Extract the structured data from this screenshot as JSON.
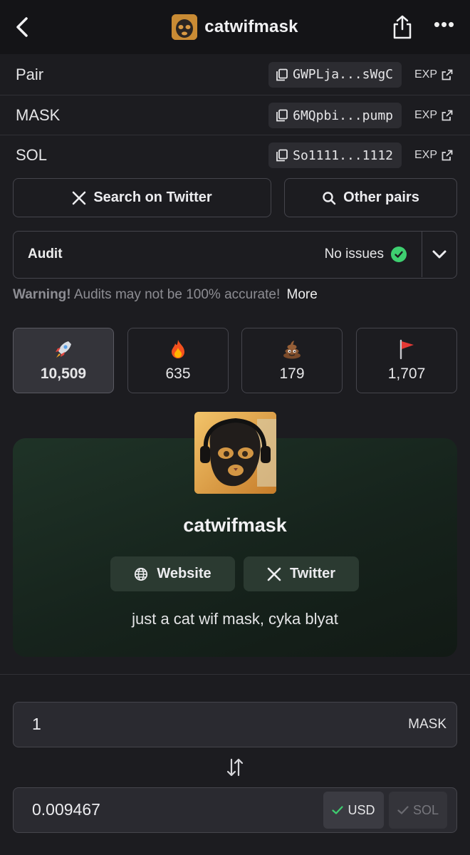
{
  "header": {
    "title": "catwifmask",
    "back_icon": "chevron-left-icon",
    "share_icon": "share-icon",
    "more_icon": "ellipsis-icon",
    "more_glyph": "•••"
  },
  "addresses": [
    {
      "label": "Pair",
      "address": "GWPLja...sWgC",
      "explorer": "EXP"
    },
    {
      "label": "MASK",
      "address": "6MQpbi...pump",
      "explorer": "EXP"
    },
    {
      "label": "SOL",
      "address": "So1111...1112",
      "explorer": "EXP"
    }
  ],
  "actions": {
    "twitter_search": "Search on Twitter",
    "other_pairs": "Other pairs"
  },
  "audit": {
    "label": "Audit",
    "status": "No issues",
    "status_color": "#3ecf70"
  },
  "warning": {
    "title": "Warning!",
    "text": "Audits may not be 100% accurate!",
    "more": "More"
  },
  "reactions": [
    {
      "icon": "rocket-icon",
      "count": "10,509",
      "active": true
    },
    {
      "icon": "fire-icon",
      "count": "635",
      "active": false
    },
    {
      "icon": "poop-icon",
      "count": "179",
      "active": false
    },
    {
      "icon": "red-flag-icon",
      "count": "1,707",
      "active": false
    }
  ],
  "token": {
    "name": "catwifmask",
    "website_label": "Website",
    "twitter_label": "Twitter",
    "description": "just a cat wif mask, cyka blyat"
  },
  "converter": {
    "amount": "1",
    "token_unit": "MASK",
    "converted": "0.009467",
    "currency_usd": "USD",
    "currency_sol": "SOL",
    "selected_currency": "USD"
  },
  "colors": {
    "background": "#1c1c20",
    "header": "#141417",
    "card_green": "#1f3327",
    "success": "#3ecf70"
  }
}
